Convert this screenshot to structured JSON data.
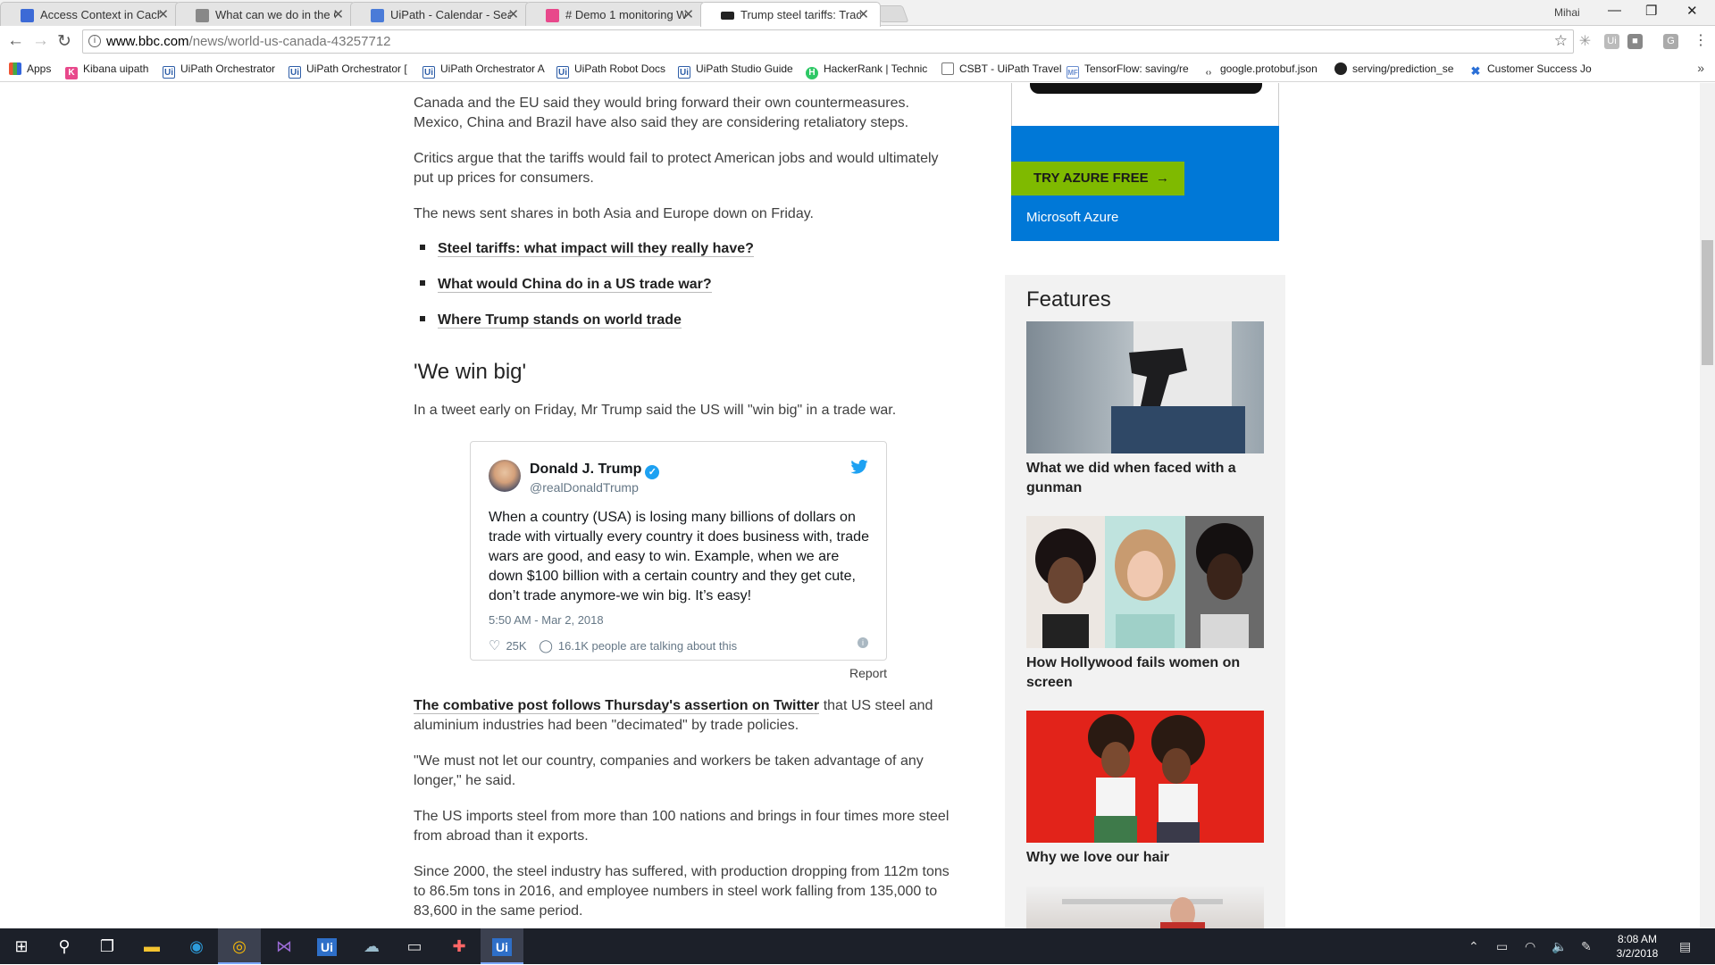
{
  "browser": {
    "tabs": [
      {
        "label": "Access Context in Cache",
        "color": "#3c6ad6"
      },
      {
        "label": "What can we do in the C",
        "color": "#666666"
      },
      {
        "label": "UiPath - Calendar - Sear",
        "color": "#4a7bd8"
      },
      {
        "label": "# Demo 1 monitoring W",
        "color": "#e8488b"
      },
      {
        "label": "Trump steel tariffs: Trade",
        "color": "#222222"
      }
    ],
    "profile": "Mihai",
    "url_host": "www.bbc.com",
    "url_path": "/news/world-us-canada-43257712",
    "bookmarks": [
      {
        "label": "Apps",
        "icon": "apps-grid-icon"
      },
      {
        "label": "Kibana uipath",
        "icon": "kibana-icon"
      },
      {
        "label": "UiPath Orchestrator",
        "icon": "uipath-icon"
      },
      {
        "label": "UiPath Orchestrator [",
        "icon": "uipath-icon"
      },
      {
        "label": "UiPath Orchestrator A",
        "icon": "uipath-icon"
      },
      {
        "label": "UiPath Robot Docs",
        "icon": "uipath-icon"
      },
      {
        "label": "UiPath Studio Guide",
        "icon": "uipath-icon"
      },
      {
        "label": "HackerRank | Technic",
        "icon": "hackerrank-icon"
      },
      {
        "label": "CSBT - UiPath Travel",
        "icon": "document-icon"
      },
      {
        "label": "TensorFlow: saving/re",
        "icon": "tensorflow-icon"
      },
      {
        "label": "google.protobuf.json",
        "icon": "code-icon"
      },
      {
        "label": "serving/prediction_se",
        "icon": "github-icon"
      },
      {
        "label": "Customer Success Jo",
        "icon": "confluence-icon"
      }
    ]
  },
  "article": {
    "p1": "Canada and the EU said they would bring forward their own countermeasures. Mexico, China and Brazil have also said they are considering retaliatory steps.",
    "p2": "Critics argue that the tariffs would fail to protect American jobs and would ultimately put up prices for consumers.",
    "p3": "The news sent shares in both Asia and Europe down on Friday.",
    "links": [
      "Steel tariffs: what impact will they really have?",
      "What would China do in a US trade war?",
      "Where Trump stands on world trade"
    ],
    "subhead": "'We win big'",
    "p4": "In a tweet early on Friday, Mr Trump said the US will \"win big\" in a trade war.",
    "p5_link": "The combative post follows Thursday's assertion on Twitter",
    "p5_rest": " that US steel and aluminium industries had been \"decimated\" by trade policies.",
    "p6": "\"We must not let our country, companies and workers be taken advantage of any longer,\" he said.",
    "p7": "The US imports steel from more than 100 nations and brings in four times more steel from abroad than it exports.",
    "p8": "Since 2000, the steel industry has suffered, with production dropping from 112m tons to 86.5m tons in 2016, and employee numbers in steel work falling from 135,000 to 83,600 in the same period."
  },
  "tweet": {
    "name": "Donald J. Trump",
    "handle": "@realDonaldTrump",
    "text": "When a country (USA) is losing many billions of dollars on trade with virtually every country it does business with, trade wars are good, and easy to win. Example, when we are down $100 billion with a certain country and they get cute, don’t trade anymore-we win big. It’s easy!",
    "time": "5:50 AM - Mar 2, 2018",
    "likes": "25K",
    "talking": "16.1K people are talking about this",
    "report": "Report"
  },
  "ad": {
    "button": "TRY AZURE FREE",
    "brand": "Microsoft Azure"
  },
  "features": {
    "title": "Features",
    "items": [
      {
        "caption": "What we did when faced with a gunman"
      },
      {
        "caption": "How Hollywood fails women on screen"
      },
      {
        "caption": "Why we love our hair"
      }
    ]
  },
  "taskbar": {
    "time": "8:08 AM",
    "date": "3/2/2018"
  }
}
